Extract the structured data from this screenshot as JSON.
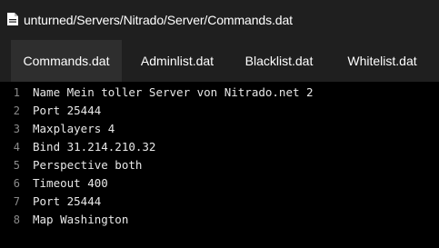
{
  "path": {
    "icon": "file-icon",
    "text": "unturned/Servers/Nitrado/Server/Commands.dat"
  },
  "tabs": [
    {
      "label": "Commands.dat",
      "active": true
    },
    {
      "label": "Adminlist.dat",
      "active": false
    },
    {
      "label": "Blacklist.dat",
      "active": false
    },
    {
      "label": "Whitelist.dat",
      "active": false
    }
  ],
  "editor": {
    "lines": [
      {
        "number": "1",
        "text": "Name Mein toller Server von Nitrado.net 2"
      },
      {
        "number": "2",
        "text": "Port 25444"
      },
      {
        "number": "3",
        "text": "Maxplayers 4"
      },
      {
        "number": "4",
        "text": "Bind 31.214.210.32"
      },
      {
        "number": "5",
        "text": "Perspective both"
      },
      {
        "number": "6",
        "text": "Timeout 400"
      },
      {
        "number": "7",
        "text": "Port 25444"
      },
      {
        "number": "8",
        "text": "Map Washington"
      }
    ]
  },
  "colors": {
    "background": "#1f1f1f",
    "active_tab": "#2e2e2e",
    "editor_background": "#000000",
    "line_number": "#8a8a8a",
    "code_text": "#e8e8e8"
  }
}
